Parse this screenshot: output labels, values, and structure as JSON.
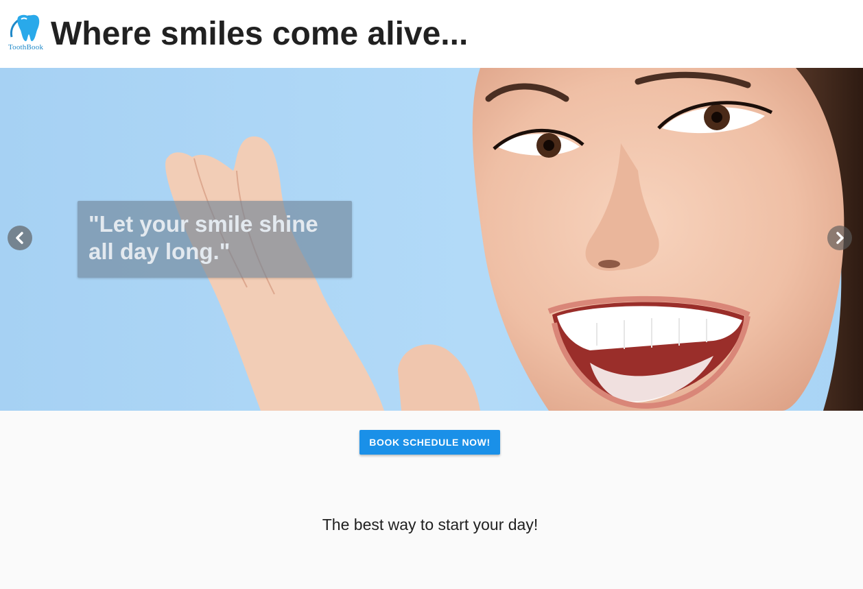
{
  "header": {
    "logo_text": "ToothBook",
    "title": "Where smiles come alive..."
  },
  "hero": {
    "caption": "\"Let your smile shine all day long.\"",
    "prev_icon": "chevron-left-icon",
    "next_icon": "chevron-right-icon"
  },
  "cta": {
    "book_label": "BOOK SCHEDULE NOW!"
  },
  "tagline": "The best way to start your day!",
  "colors": {
    "primary": "#1a90e8",
    "hero_sky": "#a9d3f4",
    "title_text": "#212121"
  }
}
